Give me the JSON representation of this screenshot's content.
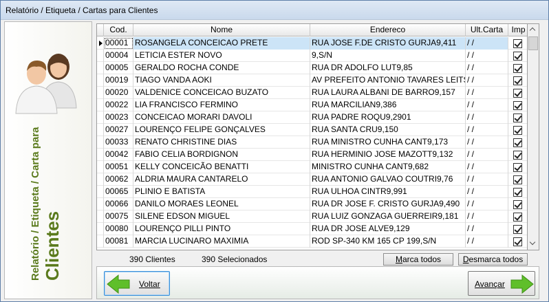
{
  "window": {
    "title": "Relatório / Etiqueta / Cartas para Clientes"
  },
  "sidebar": {
    "icon": "users-icon",
    "heading_line1": "Relatório / Etiqueta / Carta para",
    "heading_line2": "Clientes",
    "heading_color": "#5a7a1c"
  },
  "grid": {
    "columns": [
      "Cod.",
      "Nome",
      "Endereco",
      "Ult.Carta",
      "Imp"
    ],
    "rows": [
      {
        "cod": "00001",
        "nome": "ROSANGELA CONCEICAO PRETE",
        "endereco": "RUA JOSE F.DE CRISTO GURJA9,411",
        "ult": "/ /",
        "imp": true
      },
      {
        "cod": "00004",
        "nome": "LETICIA ESTER NOVO",
        "endereco": "9,S/N",
        "ult": "/ /",
        "imp": true
      },
      {
        "cod": "00005",
        "nome": "GERALDO ROCHA CONDE",
        "endereco": "RUA DR ADOLFO LUT9,85",
        "ult": "/ /",
        "imp": true
      },
      {
        "cod": "00019",
        "nome": "TIAGO VANDA AOKI",
        "endereco": "AV PREFEITO ANTONIO TAVARES LEITS",
        "ult": "/ /",
        "imp": true
      },
      {
        "cod": "00020",
        "nome": "VALDENICE CONCEICAO BUZATO",
        "endereco": "RUA LAURA ALBANI DE BARRO9,157",
        "ult": "/ /",
        "imp": true
      },
      {
        "cod": "00022",
        "nome": "LIA FRANCISCO FERMINO",
        "endereco": "RUA MARCILIAN9,386",
        "ult": "/ /",
        "imp": true
      },
      {
        "cod": "00023",
        "nome": "CONCEICAO MORARI DAVOLI",
        "endereco": "RUA PADRE ROQU9,2901",
        "ult": "/ /",
        "imp": true
      },
      {
        "cod": "00027",
        "nome": "LOURENÇO FELIPE GONÇALVES",
        "endereco": "RUA SANTA CRU9,150",
        "ult": "/ /",
        "imp": true
      },
      {
        "cod": "00033",
        "nome": "RENATO CHRISTINE DIAS",
        "endereco": "RUA MINISTRO CUNHA CANT9,173",
        "ult": "/ /",
        "imp": true
      },
      {
        "cod": "00042",
        "nome": "FABIO CELIA BORDIGNON",
        "endereco": "RUA HERMINIO JOSE MAZOTT9,132",
        "ult": "/ /",
        "imp": true
      },
      {
        "cod": "00051",
        "nome": "KELLY CONCEICÃO BENATTI",
        "endereco": "MINISTRO CUNHA CANT9,682",
        "ult": "/ /",
        "imp": true
      },
      {
        "cod": "00062",
        "nome": "ALDRIA MAURA CANTARELO",
        "endereco": "RUA ANTONIO GALVAO COUTRI9,76",
        "ult": "/ /",
        "imp": true
      },
      {
        "cod": "00065",
        "nome": "PLINIO E BATISTA",
        "endereco": "RUA ULHOA CINTR9,991",
        "ult": "/ /",
        "imp": true
      },
      {
        "cod": "00066",
        "nome": "DANILO MORAES LEONEL",
        "endereco": "RUA DR JOSE F. CRISTO GURJA9,490",
        "ult": "/ /",
        "imp": true
      },
      {
        "cod": "00075",
        "nome": "SILENE EDSON MIGUEL",
        "endereco": "RUA LUIZ GONZAGA GUERREIR9,181",
        "ult": "/ /",
        "imp": true
      },
      {
        "cod": "00080",
        "nome": "LOURENÇO PILLI PINTO",
        "endereco": "RUA DR JOSE ALVE9,129",
        "ult": "/ /",
        "imp": true
      },
      {
        "cod": "00081",
        "nome": "MARCIA LUCINARO MAXIMIA",
        "endereco": "ROD SP-340 KM 165  CP 199,S/N",
        "ult": "/ /",
        "imp": true
      }
    ]
  },
  "status": {
    "clientes": "390 Clientes",
    "selecionados": "390 Selecionados"
  },
  "buttons": {
    "marca_todos_u": "M",
    "marca_todos_rest": "arca todos",
    "desmarca_todos_u": "D",
    "desmarca_todos_rest": "esmarca todos",
    "voltar_u": "V",
    "voltar_rest": "oltar",
    "avancar_u": "A",
    "avancar_rest": "vançar"
  },
  "colors": {
    "arrow_green": "#5fbf2a",
    "selected_row": "#cce4f7",
    "accent": "#3b8fd9"
  }
}
